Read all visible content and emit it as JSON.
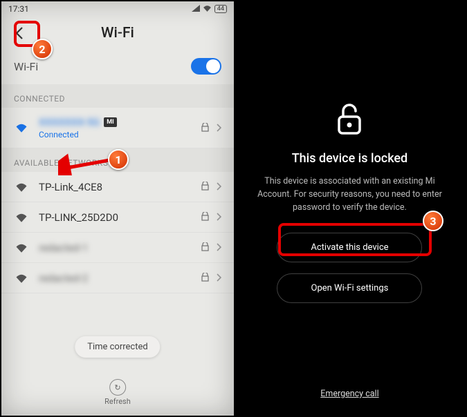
{
  "statusbar": {
    "time": "17:31",
    "battery": "44"
  },
  "header": {
    "title": "Wi-Fi"
  },
  "wifi": {
    "toggle_label": "Wi-Fi",
    "connected_section": "CONNECTED",
    "available_section": "AVAILABLE NETWORKS",
    "connected": {
      "name": "XXXXXXX-5G",
      "badge": "MI",
      "status": "Connected"
    },
    "available": [
      {
        "name": "TP-Link_4CE8",
        "locked": true
      },
      {
        "name": "TP-LINK_25D2D0",
        "locked": true
      },
      {
        "name": "redacted-1",
        "locked": true,
        "blur": true
      },
      {
        "name": "redacted-2",
        "locked": true,
        "blur": true
      }
    ]
  },
  "toast": "Time corrected",
  "refresh": {
    "label": "Refresh"
  },
  "lockscreen": {
    "title": "This device is locked",
    "body": "This device is associated with an existing Mi Account. For security reasons, you need to enter password to verify the device.",
    "activate_btn": "Activate this device",
    "wifi_btn": "Open Wi-Fi settings",
    "emergency": "Emergency call"
  },
  "callouts": {
    "c1": "1",
    "c2": "2",
    "c3": "3"
  }
}
